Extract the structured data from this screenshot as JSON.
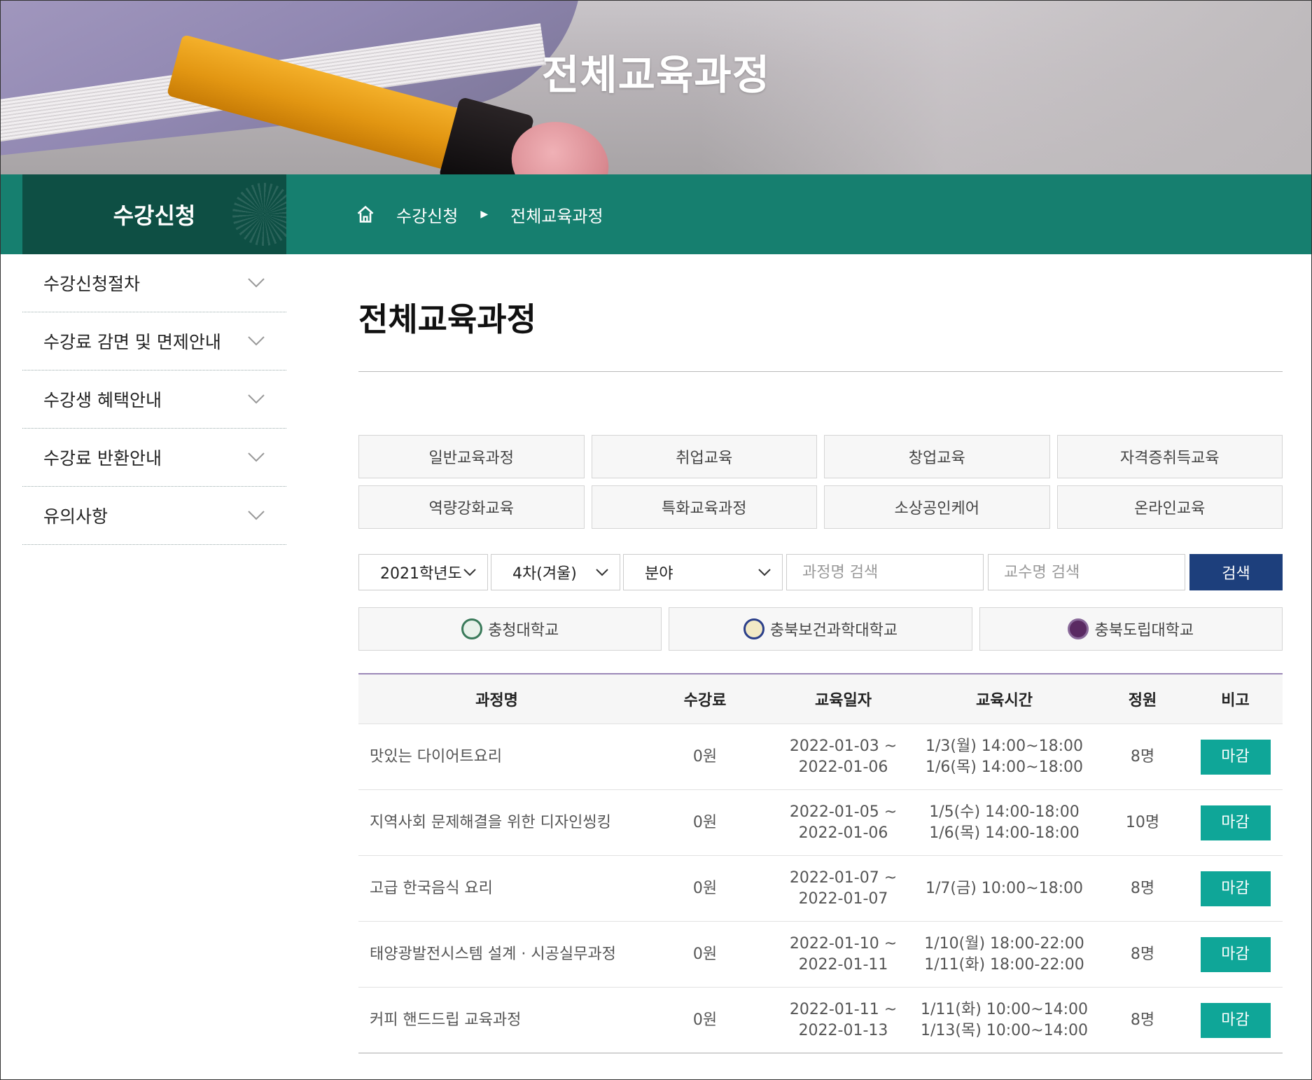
{
  "hero": {
    "title": "전체교육과정"
  },
  "bar": {
    "section_title": "수강신청",
    "breadcrumb": [
      "수강신청",
      "전체교육과정"
    ]
  },
  "sidebar": {
    "items": [
      {
        "label": "수강신청절차"
      },
      {
        "label": "수강료 감면 및 면제안내"
      },
      {
        "label": "수강생 혜택안내"
      },
      {
        "label": "수강료 반환안내"
      },
      {
        "label": "유의사항"
      }
    ]
  },
  "main": {
    "title": "전체교육과정"
  },
  "categories": [
    "일반교육과정",
    "취업교육",
    "창업교육",
    "자격증취득교육",
    "역량강화교육",
    "특화교육과정",
    "소상공인케어",
    "온라인교육"
  ],
  "filters": {
    "year": "2021학년도",
    "term": "4차(겨울)",
    "field": "분야",
    "course_placeholder": "과정명 검색",
    "professor_placeholder": "교수명 검색",
    "search_label": "검색"
  },
  "universities": [
    "충청대학교",
    "충북보건과학대학교",
    "충북도립대학교"
  ],
  "table": {
    "headers": [
      "과정명",
      "수강료",
      "교육일자",
      "교육시간",
      "정원",
      "비고"
    ],
    "rows": [
      {
        "name": "맛있는 다이어트요리",
        "fee": "0원",
        "date1": "2022-01-03 ~",
        "date2": "2022-01-06",
        "time1": "1/3(월) 14:00~18:00",
        "time2": "1/6(목) 14:00~18:00",
        "capacity": "8명",
        "status": "마감"
      },
      {
        "name": "지역사회 문제해결을 위한 디자인씽킹",
        "fee": "0원",
        "date1": "2022-01-05 ~",
        "date2": "2022-01-06",
        "time1": "1/5(수) 14:00-18:00",
        "time2": "1/6(목) 14:00-18:00",
        "capacity": "10명",
        "status": "마감"
      },
      {
        "name": "고급 한국음식 요리",
        "fee": "0원",
        "date1": "2022-01-07 ~",
        "date2": "2022-01-07",
        "time1": "1/7(금) 10:00~18:00",
        "time2": "",
        "capacity": "8명",
        "status": "마감"
      },
      {
        "name": "태양광발전시스템 설계 · 시공실무과정",
        "fee": "0원",
        "date1": "2022-01-10 ~",
        "date2": "2022-01-11",
        "time1": "1/10(월) 18:00-22:00",
        "time2": "1/11(화) 18:00-22:00",
        "capacity": "8명",
        "status": "마감"
      },
      {
        "name": "커피 핸드드립 교육과정",
        "fee": "0원",
        "date1": "2022-01-11 ~",
        "date2": "2022-01-13",
        "time1": "1/11(화) 10:00~14:00",
        "time2": "1/13(목) 10:00~14:00",
        "capacity": "8명",
        "status": "마감"
      }
    ]
  },
  "colors": {
    "bar_green": "#167f6f",
    "section_dark": "#0e4f44",
    "search_blue": "#1d3f7c",
    "closed_teal": "#0fa698",
    "table_top_border": "#9b88b7"
  }
}
